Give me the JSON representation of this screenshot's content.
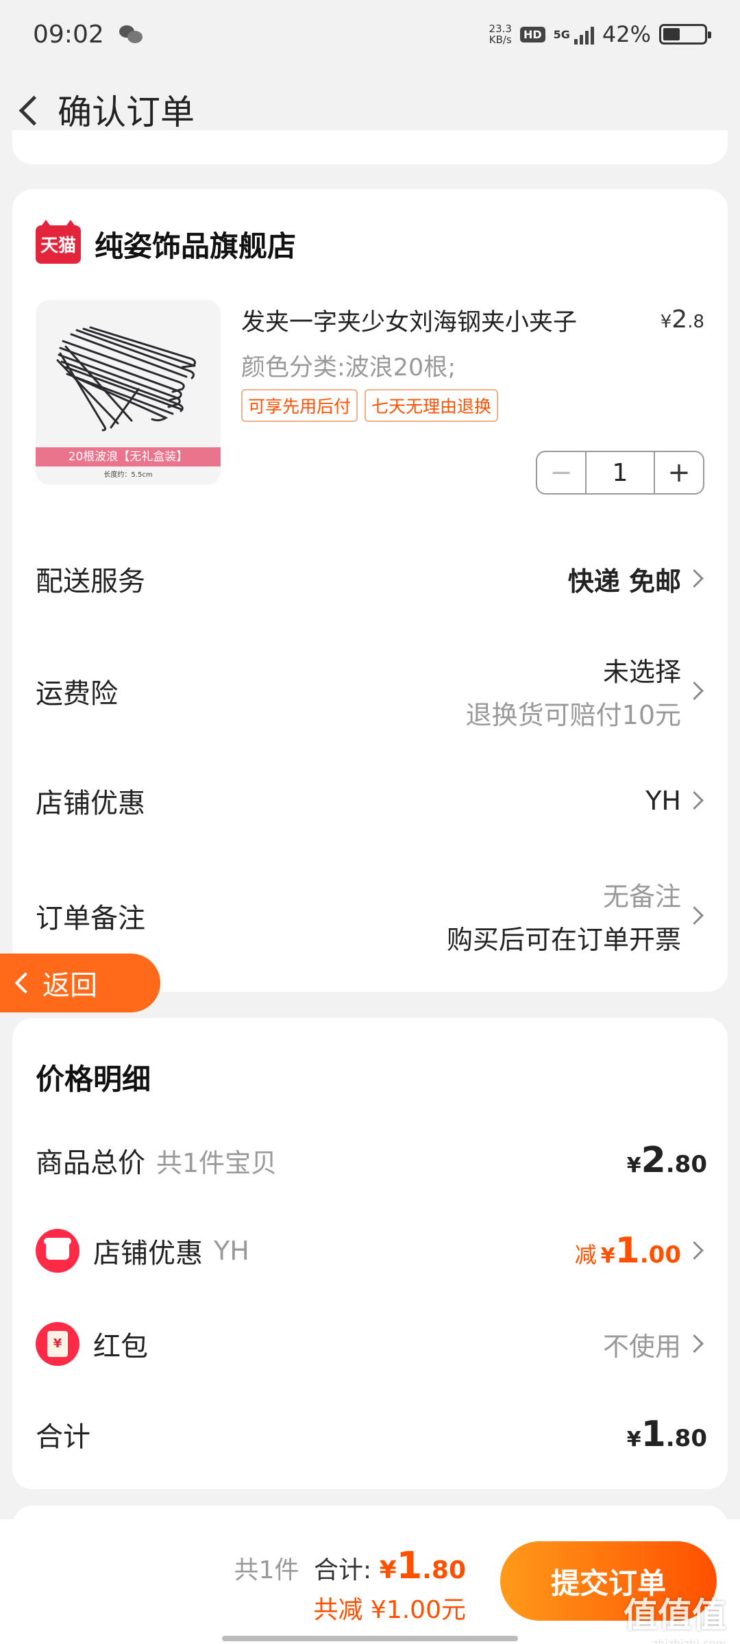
{
  "status_bar": {
    "time": "09:02",
    "net_speed_value": "23.3",
    "net_speed_unit": "KB/s",
    "hd": "HD",
    "network": "5G",
    "battery": "42%",
    "battery_level": 0.42
  },
  "header": {
    "title": "确认订单"
  },
  "shop": {
    "badge": "天猫",
    "name": "纯姿饰品旗舰店"
  },
  "product": {
    "title": "发夹一字夹少女刘海钢夹小夹子",
    "price_currency": "¥",
    "price_int": "2",
    "price_dec": ".8",
    "variant": "颜色分类:波浪20根;",
    "tags": [
      "可享先用后付",
      "七天无理由退换"
    ],
    "thumb_strip": "20根波浪【无礼盒装】",
    "thumb_caption": "长度约：5.5cm",
    "quantity": "1"
  },
  "options": {
    "delivery": {
      "label": "配送服务",
      "value": "快递 免邮"
    },
    "insurance": {
      "label": "运费险",
      "value": "未选择",
      "sub": "退换货可赔付10元"
    },
    "store_discount": {
      "label": "店铺优惠",
      "value": "YH"
    },
    "note": {
      "label": "订单备注",
      "value": "无备注",
      "sub": "购买后可在订单开票"
    }
  },
  "floating_back": {
    "label": "返回"
  },
  "price_detail": {
    "title": "价格明细",
    "goods_total": {
      "label": "商品总价",
      "sub": "共1件宝贝",
      "currency": "¥",
      "int": "2",
      "dec": ".80"
    },
    "store_discount": {
      "label": "店铺优惠",
      "sub": "YH",
      "prefix": "减",
      "currency": "¥",
      "int": "1",
      "dec": ".00"
    },
    "red_packet": {
      "label": "红包",
      "value": "不使用",
      "glyph": "¥"
    },
    "total": {
      "label": "合计",
      "currency": "¥",
      "int": "1",
      "dec": ".80"
    }
  },
  "bottom_bar": {
    "count": "共1件",
    "sum_label": "合计:",
    "currency": "¥",
    "sum_int": "1",
    "sum_dec": ".80",
    "saved": "共减 ¥1.00元",
    "submit": "提交订单"
  },
  "watermark": {
    "main": "值值值",
    "sub": "zhizhizhi.com"
  },
  "colors": {
    "accent": "#ff5000",
    "tmall_red": "#e4243a",
    "back_pill": "#ff6a1a"
  }
}
